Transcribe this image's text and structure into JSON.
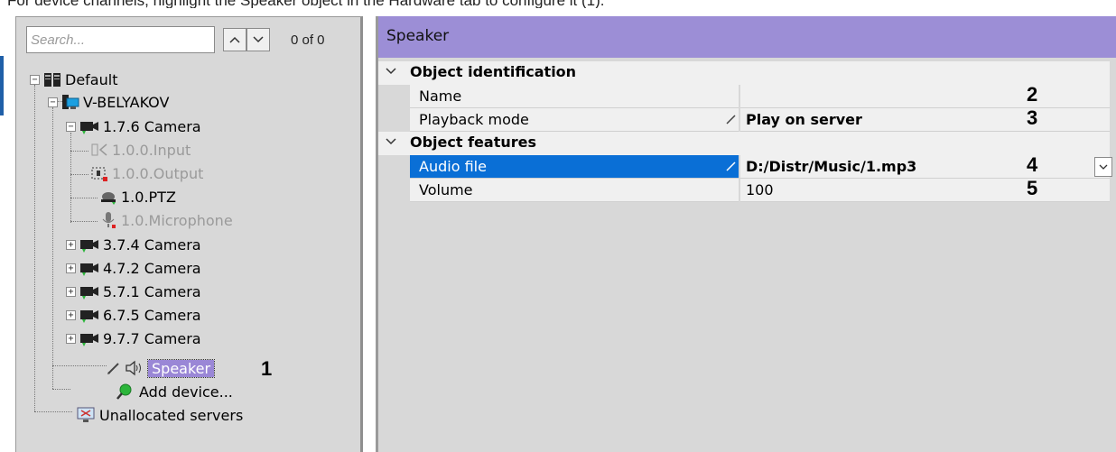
{
  "caption": "For device channels, highlight the Speaker object in the Hardware tab to configure it (1).",
  "search": {
    "placeholder": "Search...",
    "count": "0 of 0"
  },
  "tree": {
    "root": "Default",
    "server": "V-BELYAKOV",
    "camera_expanded": "1.7.6 Camera",
    "child_input": "1.0.0.Input",
    "child_output": "1.0.0.Output",
    "child_ptz": "1.0.PTZ",
    "child_mic": "1.0.Microphone",
    "cameras": [
      "3.7.4 Camera",
      "4.7.2 Camera",
      "5.7.1 Camera",
      "6.7.5 Camera",
      "9.7.7 Camera"
    ],
    "speaker": "Speaker",
    "add_device": "Add device...",
    "unallocated": "Unallocated servers"
  },
  "callouts": {
    "c1": "1",
    "c2": "2",
    "c3": "3",
    "c4": "4",
    "c5": "5"
  },
  "properties": {
    "title": "Speaker",
    "section_identification": "Object identification",
    "name_label": "Name",
    "name_value": "",
    "playback_label": "Playback mode",
    "playback_value": "Play on server",
    "section_features": "Object features",
    "audio_label": "Audio file",
    "audio_value": "D:/Distr/Music/1.mp3",
    "volume_label": "Volume",
    "volume_value": "100"
  },
  "colors": {
    "header_accent": "#9c8ed6",
    "selection_blue": "#0a6fd6",
    "tree_selection": "#9a87d6"
  }
}
